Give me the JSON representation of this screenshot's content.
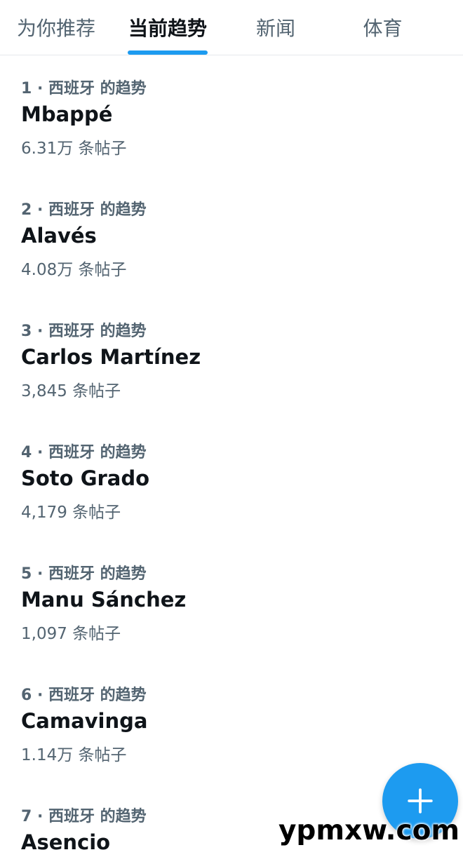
{
  "tabs": [
    {
      "label": "为你推荐",
      "active": false
    },
    {
      "label": "当前趋势",
      "active": true
    },
    {
      "label": "新闻",
      "active": false
    },
    {
      "label": "体育",
      "active": false
    }
  ],
  "trends": [
    {
      "meta": "1 · 西班牙 的趋势",
      "name": "Mbappé",
      "count": "6.31万 条帖子"
    },
    {
      "meta": "2 · 西班牙 的趋势",
      "name": "Alavés",
      "count": "4.08万 条帖子"
    },
    {
      "meta": "3 · 西班牙 的趋势",
      "name": "Carlos Martínez",
      "count": "3,845 条帖子"
    },
    {
      "meta": "4 · 西班牙 的趋势",
      "name": "Soto Grado",
      "count": "4,179 条帖子"
    },
    {
      "meta": "5 · 西班牙 的趋势",
      "name": "Manu Sánchez",
      "count": "1,097 条帖子"
    },
    {
      "meta": "6 · 西班牙 的趋势",
      "name": "Camavinga",
      "count": "1.14万 条帖子"
    },
    {
      "meta": "7 · 西班牙 的趋势",
      "name": "Asencio",
      "count": ""
    }
  ],
  "fab": {
    "icon": "plus-icon"
  },
  "watermark": "ypmxw.com",
  "colors": {
    "accent": "#1d9bf0",
    "text_primary": "#0f1419",
    "text_secondary": "#536471"
  }
}
